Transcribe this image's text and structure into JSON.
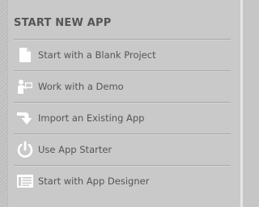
{
  "panel": {
    "title": "START NEW APP",
    "items": [
      {
        "label": "Start with a Blank Project",
        "icon": "blank-document-icon"
      },
      {
        "label": "Work with a Demo",
        "icon": "presenter-icon"
      },
      {
        "label": "Import an Existing App",
        "icon": "import-arrow-icon"
      },
      {
        "label": "Use App Starter",
        "icon": "power-icon"
      },
      {
        "label": "Start with App Designer",
        "icon": "designer-window-icon"
      }
    ]
  },
  "colors": {
    "background": "#c9c9c9",
    "text": "#555555",
    "icon": "#ffffff",
    "divider": "#a8a8a8"
  }
}
